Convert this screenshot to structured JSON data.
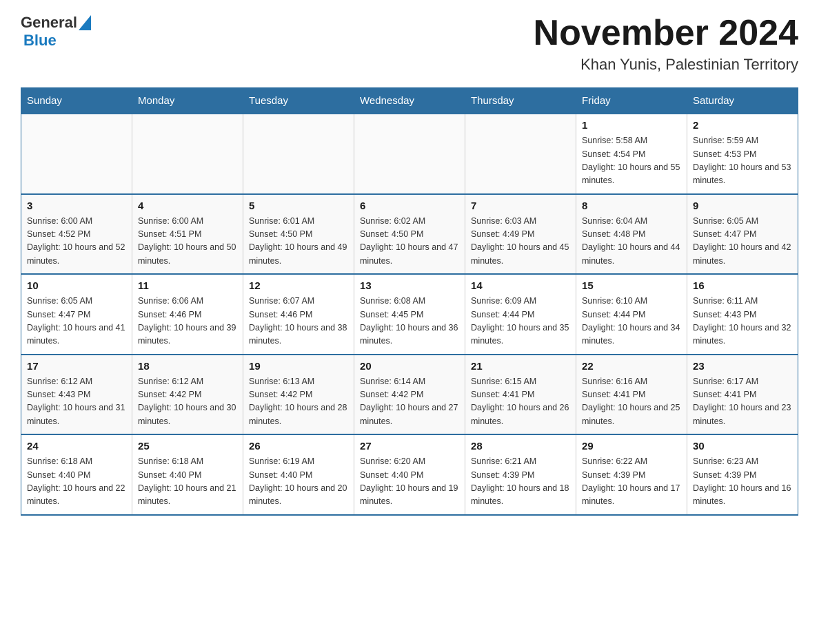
{
  "logo": {
    "general": "General",
    "blue": "Blue",
    "triangle_color": "#1a7abf"
  },
  "title": "November 2024",
  "subtitle": "Khan Yunis, Palestinian Territory",
  "days_of_week": [
    "Sunday",
    "Monday",
    "Tuesday",
    "Wednesday",
    "Thursday",
    "Friday",
    "Saturday"
  ],
  "weeks": [
    [
      {
        "day": "",
        "info": ""
      },
      {
        "day": "",
        "info": ""
      },
      {
        "day": "",
        "info": ""
      },
      {
        "day": "",
        "info": ""
      },
      {
        "day": "",
        "info": ""
      },
      {
        "day": "1",
        "info": "Sunrise: 5:58 AM\nSunset: 4:54 PM\nDaylight: 10 hours and 55 minutes."
      },
      {
        "day": "2",
        "info": "Sunrise: 5:59 AM\nSunset: 4:53 PM\nDaylight: 10 hours and 53 minutes."
      }
    ],
    [
      {
        "day": "3",
        "info": "Sunrise: 6:00 AM\nSunset: 4:52 PM\nDaylight: 10 hours and 52 minutes."
      },
      {
        "day": "4",
        "info": "Sunrise: 6:00 AM\nSunset: 4:51 PM\nDaylight: 10 hours and 50 minutes."
      },
      {
        "day": "5",
        "info": "Sunrise: 6:01 AM\nSunset: 4:50 PM\nDaylight: 10 hours and 49 minutes."
      },
      {
        "day": "6",
        "info": "Sunrise: 6:02 AM\nSunset: 4:50 PM\nDaylight: 10 hours and 47 minutes."
      },
      {
        "day": "7",
        "info": "Sunrise: 6:03 AM\nSunset: 4:49 PM\nDaylight: 10 hours and 45 minutes."
      },
      {
        "day": "8",
        "info": "Sunrise: 6:04 AM\nSunset: 4:48 PM\nDaylight: 10 hours and 44 minutes."
      },
      {
        "day": "9",
        "info": "Sunrise: 6:05 AM\nSunset: 4:47 PM\nDaylight: 10 hours and 42 minutes."
      }
    ],
    [
      {
        "day": "10",
        "info": "Sunrise: 6:05 AM\nSunset: 4:47 PM\nDaylight: 10 hours and 41 minutes."
      },
      {
        "day": "11",
        "info": "Sunrise: 6:06 AM\nSunset: 4:46 PM\nDaylight: 10 hours and 39 minutes."
      },
      {
        "day": "12",
        "info": "Sunrise: 6:07 AM\nSunset: 4:46 PM\nDaylight: 10 hours and 38 minutes."
      },
      {
        "day": "13",
        "info": "Sunrise: 6:08 AM\nSunset: 4:45 PM\nDaylight: 10 hours and 36 minutes."
      },
      {
        "day": "14",
        "info": "Sunrise: 6:09 AM\nSunset: 4:44 PM\nDaylight: 10 hours and 35 minutes."
      },
      {
        "day": "15",
        "info": "Sunrise: 6:10 AM\nSunset: 4:44 PM\nDaylight: 10 hours and 34 minutes."
      },
      {
        "day": "16",
        "info": "Sunrise: 6:11 AM\nSunset: 4:43 PM\nDaylight: 10 hours and 32 minutes."
      }
    ],
    [
      {
        "day": "17",
        "info": "Sunrise: 6:12 AM\nSunset: 4:43 PM\nDaylight: 10 hours and 31 minutes."
      },
      {
        "day": "18",
        "info": "Sunrise: 6:12 AM\nSunset: 4:42 PM\nDaylight: 10 hours and 30 minutes."
      },
      {
        "day": "19",
        "info": "Sunrise: 6:13 AM\nSunset: 4:42 PM\nDaylight: 10 hours and 28 minutes."
      },
      {
        "day": "20",
        "info": "Sunrise: 6:14 AM\nSunset: 4:42 PM\nDaylight: 10 hours and 27 minutes."
      },
      {
        "day": "21",
        "info": "Sunrise: 6:15 AM\nSunset: 4:41 PM\nDaylight: 10 hours and 26 minutes."
      },
      {
        "day": "22",
        "info": "Sunrise: 6:16 AM\nSunset: 4:41 PM\nDaylight: 10 hours and 25 minutes."
      },
      {
        "day": "23",
        "info": "Sunrise: 6:17 AM\nSunset: 4:41 PM\nDaylight: 10 hours and 23 minutes."
      }
    ],
    [
      {
        "day": "24",
        "info": "Sunrise: 6:18 AM\nSunset: 4:40 PM\nDaylight: 10 hours and 22 minutes."
      },
      {
        "day": "25",
        "info": "Sunrise: 6:18 AM\nSunset: 4:40 PM\nDaylight: 10 hours and 21 minutes."
      },
      {
        "day": "26",
        "info": "Sunrise: 6:19 AM\nSunset: 4:40 PM\nDaylight: 10 hours and 20 minutes."
      },
      {
        "day": "27",
        "info": "Sunrise: 6:20 AM\nSunset: 4:40 PM\nDaylight: 10 hours and 19 minutes."
      },
      {
        "day": "28",
        "info": "Sunrise: 6:21 AM\nSunset: 4:39 PM\nDaylight: 10 hours and 18 minutes."
      },
      {
        "day": "29",
        "info": "Sunrise: 6:22 AM\nSunset: 4:39 PM\nDaylight: 10 hours and 17 minutes."
      },
      {
        "day": "30",
        "info": "Sunrise: 6:23 AM\nSunset: 4:39 PM\nDaylight: 10 hours and 16 minutes."
      }
    ]
  ]
}
